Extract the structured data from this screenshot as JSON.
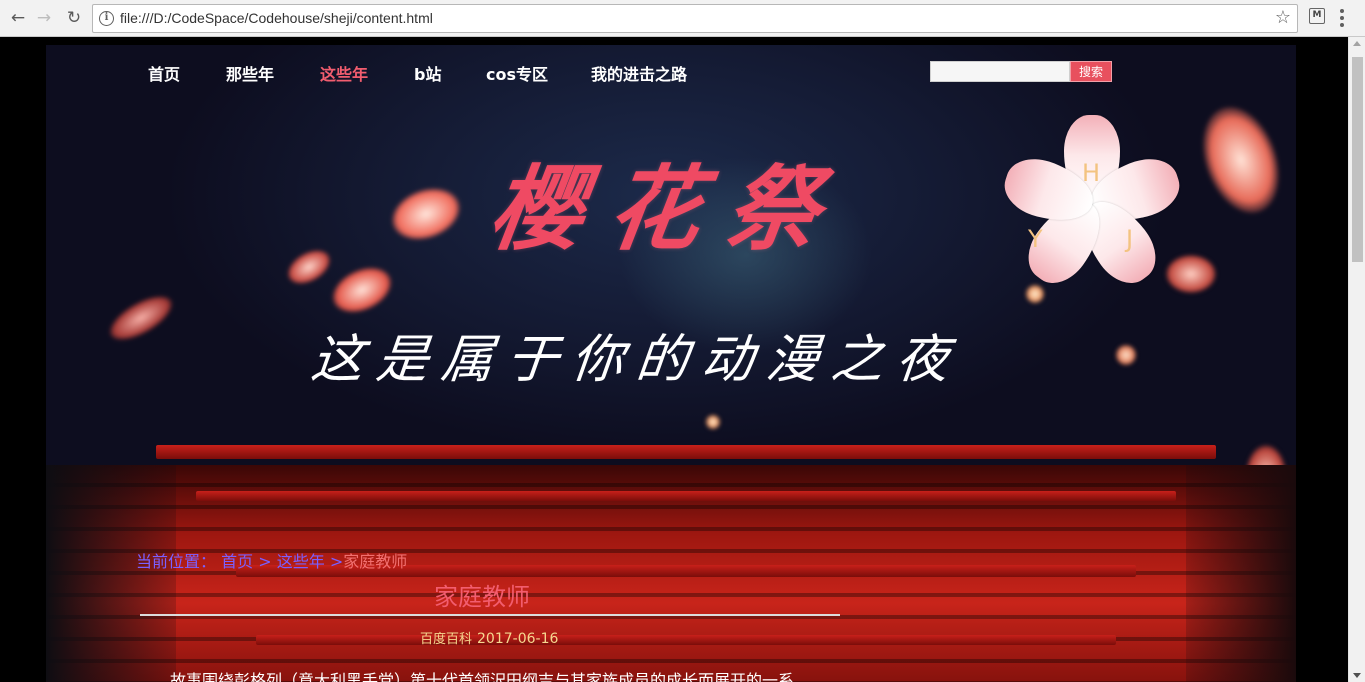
{
  "browser": {
    "url": "file:///D:/CodeSpace/Codehouse/sheji/content.html"
  },
  "nav": {
    "items": [
      "首页",
      "那些年",
      "这些年",
      "b站",
      "cos专区",
      "我的进击之路"
    ],
    "active_index": 2
  },
  "search": {
    "value": "",
    "button_label": "搜索"
  },
  "banner": {
    "title": "樱花祭",
    "subtitle": "这是属于你的动漫之夜",
    "logo_letters": [
      "H",
      "Y",
      "J"
    ]
  },
  "breadcrumb": {
    "label": "当前位置：",
    "home": "首页",
    "sep1": ">",
    "section": "这些年",
    "sep2": ">",
    "current": "家庭教师"
  },
  "article": {
    "title": "家庭教师",
    "source": "百度百科",
    "date": "2017-06-16",
    "body_first_line": "故事围绕彭格列（意大利黑手党）第十代首领沢田纲吉与其家族成员的成长而展开的一系"
  },
  "colors": {
    "accent": "#f25d6f",
    "breadcrumb": "#7a60ff",
    "search_button": "#e8505e",
    "meta": "#f6d890"
  }
}
